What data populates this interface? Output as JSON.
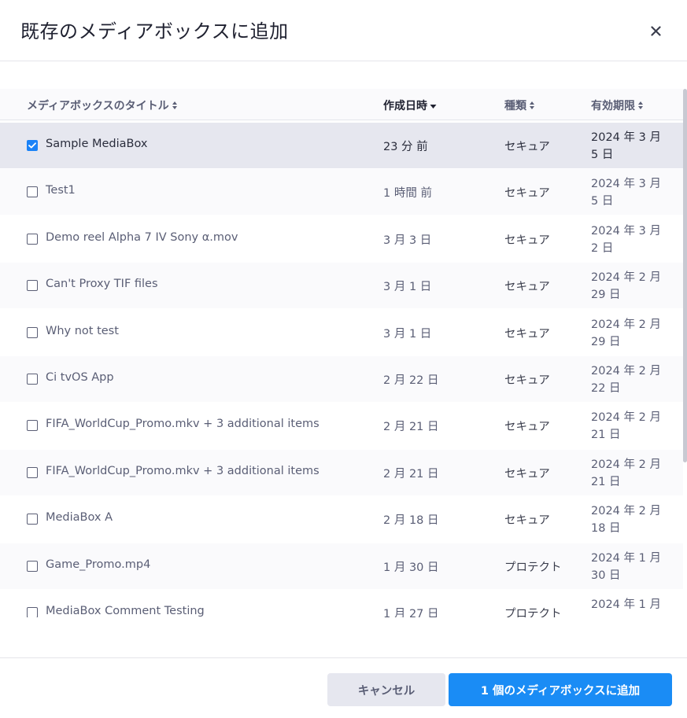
{
  "dialog": {
    "title": "既存のメディアボックスに追加",
    "close_icon": "close-icon"
  },
  "table": {
    "columns": [
      {
        "label": "メディアボックスのタイトル",
        "sort": "both"
      },
      {
        "label": "作成日時",
        "sort": "desc"
      },
      {
        "label": "種類",
        "sort": "both"
      },
      {
        "label": "有効期限",
        "sort": "both"
      }
    ],
    "rows": [
      {
        "title": "Sample MediaBox",
        "created": "23 分 前",
        "type": "セキュア",
        "expires": "2024 年 3 月 5 日",
        "checked": true
      },
      {
        "title": "Test1",
        "created": "1 時間 前",
        "type": "セキュア",
        "expires": "2024 年 3 月 5 日",
        "checked": false
      },
      {
        "title": "Demo reel Alpha 7 IV Sony α.mov",
        "created": "3 月 3 日",
        "type": "セキュア",
        "expires": "2024 年 3 月 2 日",
        "checked": false
      },
      {
        "title": "Can't Proxy TIF files",
        "created": "3 月 1 日",
        "type": "セキュア",
        "expires": "2024 年 2 月 29 日",
        "checked": false
      },
      {
        "title": "Why not test",
        "created": "3 月 1 日",
        "type": "セキュア",
        "expires": "2024 年 2 月 29 日",
        "checked": false
      },
      {
        "title": "Ci tvOS App",
        "created": "2 月 22 日",
        "type": "セキュア",
        "expires": "2024 年 2 月 22 日",
        "checked": false
      },
      {
        "title": "FIFA_WorldCup_Promo.mkv + 3 additional items",
        "created": "2 月 21 日",
        "type": "セキュア",
        "expires": "2024 年 2 月 21 日",
        "checked": false
      },
      {
        "title": "FIFA_WorldCup_Promo.mkv + 3 additional items",
        "created": "2 月 21 日",
        "type": "セキュア",
        "expires": "2024 年 2 月 21 日",
        "checked": false
      },
      {
        "title": "MediaBox A",
        "created": "2 月 18 日",
        "type": "セキュア",
        "expires": "2024 年 2 月 18 日",
        "checked": false
      },
      {
        "title": "Game_Promo.mp4",
        "created": "1 月 30 日",
        "type": "プロテクト",
        "expires": "2024 年 1 月 30 日",
        "checked": false
      },
      {
        "title": "MediaBox Comment Testing",
        "created": "1 月 27 日",
        "type": "プロテクト",
        "expires": "2024 年 1 月",
        "checked": false
      }
    ]
  },
  "footer": {
    "cancel_label": "キャンセル",
    "add_label": "1 個のメディアボックスに追加"
  },
  "colors": {
    "accent": "#1a8cf5",
    "selected_row": "#e6e7ef"
  }
}
